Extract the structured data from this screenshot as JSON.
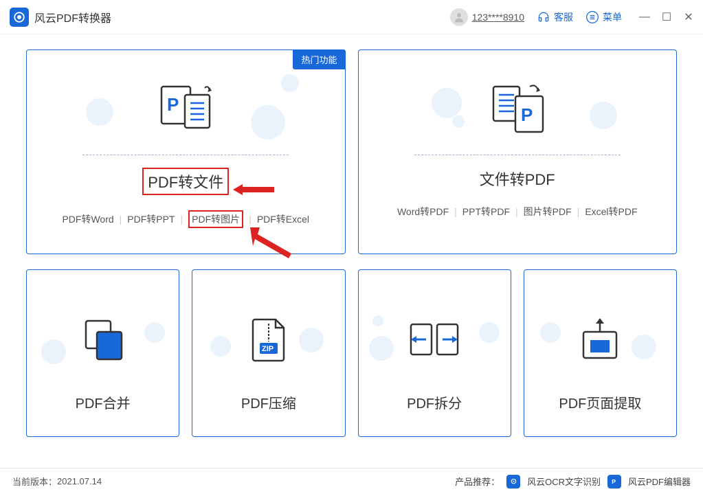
{
  "app": {
    "title": "风云PDF转换器"
  },
  "header": {
    "user_id": "123****8910",
    "support": "客服",
    "menu": "菜单"
  },
  "cards": {
    "hot_badge": "热门功能",
    "pdf_to_file": {
      "title": "PDF转文件",
      "subs": {
        "word": "PDF转Word",
        "ppt": "PDF转PPT",
        "img": "PDF转图片",
        "excel": "PDF转Excel"
      }
    },
    "file_to_pdf": {
      "title": "文件转PDF",
      "subs": {
        "word": "Word转PDF",
        "ppt": "PPT转PDF",
        "img": "图片转PDF",
        "excel": "Excel转PDF"
      }
    },
    "merge": "PDF合并",
    "compress": "PDF压缩",
    "split": "PDF拆分",
    "extract": "PDF页面提取"
  },
  "footer": {
    "version_label": "当前版本：",
    "version": "2021.07.14",
    "recommend": "产品推荐：",
    "ocr": "风云OCR文字识别",
    "editor": "风云PDF编辑器"
  }
}
